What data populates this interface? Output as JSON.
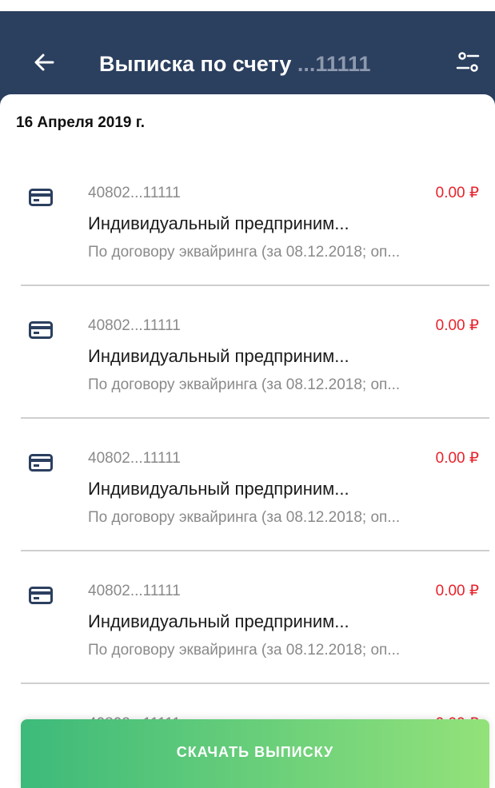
{
  "header": {
    "title": "Выписка по счету",
    "account_suffix": " ...11111"
  },
  "date_group": "16 Апреля 2019 г.",
  "transactions": [
    {
      "account": "40802...11111",
      "amount": "0.00 ₽",
      "name": "Индивидуальный предприним...",
      "description": "По договору эквайринга (за 08.12.2018; оп..."
    },
    {
      "account": "40802...11111",
      "amount": "0.00 ₽",
      "name": "Индивидуальный предприним...",
      "description": "По договору эквайринга (за 08.12.2018; оп..."
    },
    {
      "account": "40802...11111",
      "amount": "0.00 ₽",
      "name": "Индивидуальный предприним...",
      "description": "По договору эквайринга (за 08.12.2018; оп..."
    },
    {
      "account": "40802...11111",
      "amount": "0.00 ₽",
      "name": "Индивидуальный предприним...",
      "description": "По договору эквайринга (за 08.12.2018; оп..."
    },
    {
      "account": "40802...11111",
      "amount": "0.00 ₽",
      "name": "",
      "description": ""
    }
  ],
  "download_label": "СКАЧАТЬ ВЫПИСКУ",
  "colors": {
    "header_bg": "#2b3f5f",
    "amount_negative": "#e8222b",
    "button_gradient_start": "#3dba7a",
    "button_gradient_end": "#93e27a"
  },
  "icons": {
    "back": "arrow-left-icon",
    "filter": "filter-sliders-icon",
    "transaction": "card-icon"
  }
}
